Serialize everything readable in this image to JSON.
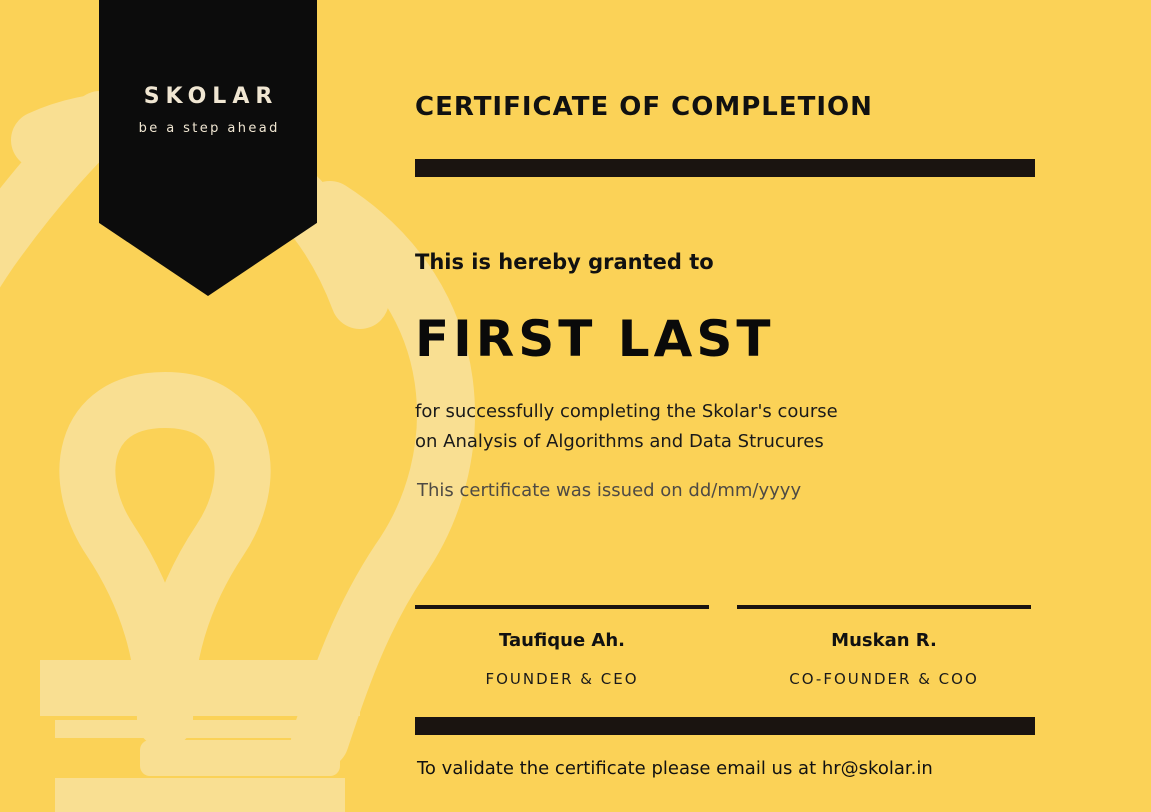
{
  "brand": {
    "name": "SKOLAR",
    "tagline": "be a step ahead"
  },
  "certificate": {
    "title": "CERTIFICATE OF COMPLETION",
    "granted_text": "This is hereby granted to",
    "recipient": "FIRST LAST",
    "description_line1": "for successfully completing the Skolar's course",
    "description_line2": "on Analysis of Algorithms and Data Strucures",
    "issued_text": "This certificate was issued on dd/mm/yyyy"
  },
  "signatories": [
    {
      "name": "Taufique Ah.",
      "role": "FOUNDER & CEO"
    },
    {
      "name": "Muskan R.",
      "role": "CO-FOUNDER & COO"
    }
  ],
  "footer": {
    "validate_text": "To validate the certificate please email us at hr@skolar.in"
  },
  "colors": {
    "background": "#FBD257",
    "ribbon": "#0c0c0c",
    "accent_bar": "#1a1410",
    "bulb": "#F9DF92"
  }
}
